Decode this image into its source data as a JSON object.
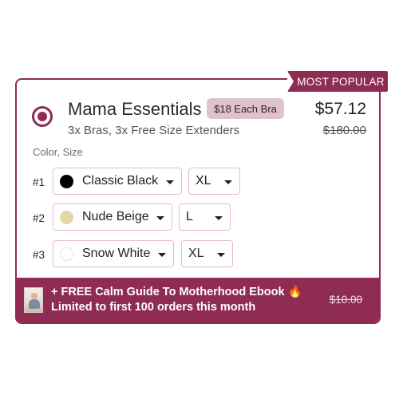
{
  "badge_popular": "MOST POPULAR",
  "product": {
    "title": "Mama Essentials",
    "badge": "$18 Each Bra",
    "price": "$57.12",
    "subtitle": "3x Bras, 3x Free Size Extenders",
    "old_price": "$180.00",
    "selected": true
  },
  "options_label": "Color, Size",
  "rows": [
    {
      "num": "#1",
      "color": "Classic Black",
      "swatch": "#000000",
      "size": "XL"
    },
    {
      "num": "#2",
      "color": "Nude Beige",
      "swatch": "#e6d6a6",
      "size": "L"
    },
    {
      "num": "#3",
      "color": "Snow White",
      "swatch": "#ffffff",
      "size": "XL"
    }
  ],
  "footer": {
    "line1": "+ FREE Calm Guide To Motherhood Ebook 🔥",
    "line2": "Limited to first 100 orders this month",
    "old_price": "$10.00",
    "thumb_icon": "ebook-cover-thumbnail"
  },
  "colors": {
    "accent": "#8f2c54",
    "badge_bg": "#dfc3cb",
    "select_border": "#e6bcc9"
  }
}
